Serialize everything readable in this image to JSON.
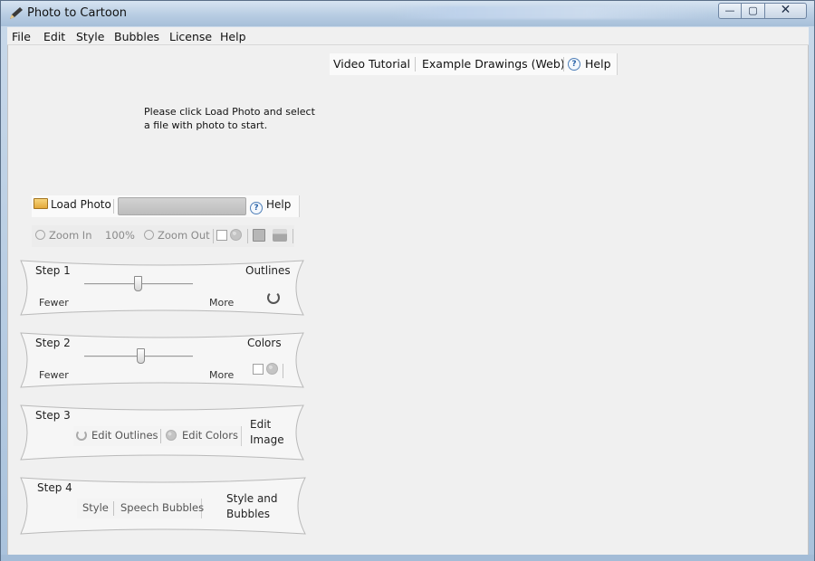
{
  "window": {
    "title": "Photo to Cartoon",
    "controls": {
      "minimize": "—",
      "maximize": "▢",
      "close": "✕"
    }
  },
  "menu": [
    "File",
    "Edit",
    "Style",
    "Bubbles",
    "License",
    "Help"
  ],
  "top_links": {
    "video_tutorial": "Video Tutorial",
    "example_drawings": "Example Drawings (Web)",
    "help": "Help"
  },
  "instruction": "Please click Load Photo and select a file with photo to start.",
  "load_bar": {
    "load_photo": "Load Photo",
    "help": "Help"
  },
  "zoom_bar": {
    "zoom_in": "Zoom In",
    "zoom_level": "100%",
    "zoom_out": "Zoom Out"
  },
  "steps": {
    "step1": {
      "title": "Step 1",
      "label": "Outlines",
      "fewer": "Fewer",
      "more": "More",
      "slider_value": 0.5
    },
    "step2": {
      "title": "Step 2",
      "label": "Colors",
      "fewer": "Fewer",
      "more": "More",
      "slider_value": 0.52
    },
    "step3": {
      "title": "Step 3",
      "edit_outlines": "Edit Outlines",
      "edit_colors": "Edit Colors",
      "label_line1": "Edit",
      "label_line2": "Image"
    },
    "step4": {
      "title": "Step 4",
      "style": "Style",
      "speech_bubbles": "Speech Bubbles",
      "label_line1": "Style and",
      "label_line2": "Bubbles"
    }
  },
  "icons": {
    "help": "question-bubble-icon",
    "load": "folder-open-icon",
    "zoom_in": "magnifier-plus-icon",
    "zoom_out": "magnifier-minus-icon",
    "save": "floppy-disk-icon",
    "print": "printer-icon",
    "reset": "refresh-icon",
    "palette": "palette-icon"
  }
}
